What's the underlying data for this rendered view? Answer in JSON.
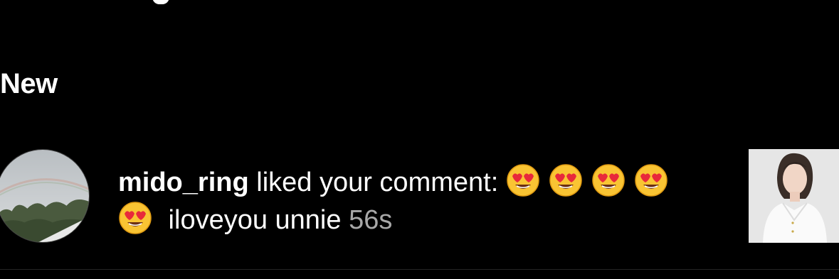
{
  "section": {
    "title": "New"
  },
  "notification": {
    "username": "mido_ring",
    "action_text": " liked your comment: ",
    "emoji_icon": "smiling-face-with-heart-eyes",
    "comment_text": " iloveyou unnie ",
    "time": "56s"
  },
  "colors": {
    "background": "#000000",
    "text": "#ffffff",
    "secondary_text": "#a8a8a8",
    "divider": "#262626"
  }
}
